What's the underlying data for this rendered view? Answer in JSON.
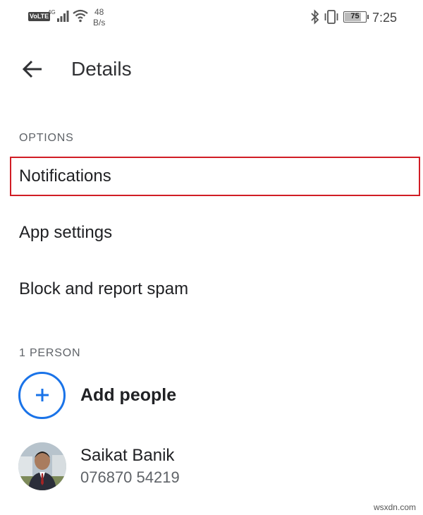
{
  "status_bar": {
    "volte": "VoLTE",
    "network": "4G",
    "speed_value": "48",
    "speed_unit": "B/s",
    "battery_level": "75",
    "time": "7:25",
    "icons": [
      "signal-icon",
      "wifi-icon",
      "bluetooth-icon",
      "vibrate-icon",
      "battery-icon"
    ]
  },
  "app_bar": {
    "title": "Details",
    "back_icon": "arrow-left-icon"
  },
  "options": {
    "header": "OPTIONS",
    "items": [
      {
        "label": "Notifications",
        "highlighted": true
      },
      {
        "label": "App settings"
      },
      {
        "label": "Block and report spam"
      }
    ]
  },
  "people": {
    "header": "1 PERSON",
    "add_label": "Add people",
    "add_icon": "plus-icon",
    "contact": {
      "name": "Saikat Banik",
      "phone": "076870 54219"
    }
  },
  "colors": {
    "accent": "#1a73e8",
    "highlight_border": "#d11d25",
    "text_primary": "#202124",
    "text_secondary": "#5f6368"
  },
  "watermark": "wsxdn.com"
}
